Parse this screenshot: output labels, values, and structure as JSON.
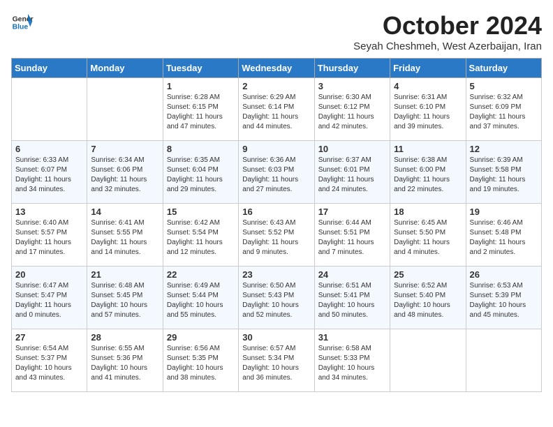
{
  "header": {
    "logo_general": "General",
    "logo_blue": "Blue",
    "month_title": "October 2024",
    "subtitle": "Seyah Cheshmeh, West Azerbaijan, Iran"
  },
  "days_of_week": [
    "Sunday",
    "Monday",
    "Tuesday",
    "Wednesday",
    "Thursday",
    "Friday",
    "Saturday"
  ],
  "weeks": [
    [
      {
        "day": "",
        "info": ""
      },
      {
        "day": "",
        "info": ""
      },
      {
        "day": "1",
        "info": "Sunrise: 6:28 AM\nSunset: 6:15 PM\nDaylight: 11 hours and 47 minutes."
      },
      {
        "day": "2",
        "info": "Sunrise: 6:29 AM\nSunset: 6:14 PM\nDaylight: 11 hours and 44 minutes."
      },
      {
        "day": "3",
        "info": "Sunrise: 6:30 AM\nSunset: 6:12 PM\nDaylight: 11 hours and 42 minutes."
      },
      {
        "day": "4",
        "info": "Sunrise: 6:31 AM\nSunset: 6:10 PM\nDaylight: 11 hours and 39 minutes."
      },
      {
        "day": "5",
        "info": "Sunrise: 6:32 AM\nSunset: 6:09 PM\nDaylight: 11 hours and 37 minutes."
      }
    ],
    [
      {
        "day": "6",
        "info": "Sunrise: 6:33 AM\nSunset: 6:07 PM\nDaylight: 11 hours and 34 minutes."
      },
      {
        "day": "7",
        "info": "Sunrise: 6:34 AM\nSunset: 6:06 PM\nDaylight: 11 hours and 32 minutes."
      },
      {
        "day": "8",
        "info": "Sunrise: 6:35 AM\nSunset: 6:04 PM\nDaylight: 11 hours and 29 minutes."
      },
      {
        "day": "9",
        "info": "Sunrise: 6:36 AM\nSunset: 6:03 PM\nDaylight: 11 hours and 27 minutes."
      },
      {
        "day": "10",
        "info": "Sunrise: 6:37 AM\nSunset: 6:01 PM\nDaylight: 11 hours and 24 minutes."
      },
      {
        "day": "11",
        "info": "Sunrise: 6:38 AM\nSunset: 6:00 PM\nDaylight: 11 hours and 22 minutes."
      },
      {
        "day": "12",
        "info": "Sunrise: 6:39 AM\nSunset: 5:58 PM\nDaylight: 11 hours and 19 minutes."
      }
    ],
    [
      {
        "day": "13",
        "info": "Sunrise: 6:40 AM\nSunset: 5:57 PM\nDaylight: 11 hours and 17 minutes."
      },
      {
        "day": "14",
        "info": "Sunrise: 6:41 AM\nSunset: 5:55 PM\nDaylight: 11 hours and 14 minutes."
      },
      {
        "day": "15",
        "info": "Sunrise: 6:42 AM\nSunset: 5:54 PM\nDaylight: 11 hours and 12 minutes."
      },
      {
        "day": "16",
        "info": "Sunrise: 6:43 AM\nSunset: 5:52 PM\nDaylight: 11 hours and 9 minutes."
      },
      {
        "day": "17",
        "info": "Sunrise: 6:44 AM\nSunset: 5:51 PM\nDaylight: 11 hours and 7 minutes."
      },
      {
        "day": "18",
        "info": "Sunrise: 6:45 AM\nSunset: 5:50 PM\nDaylight: 11 hours and 4 minutes."
      },
      {
        "day": "19",
        "info": "Sunrise: 6:46 AM\nSunset: 5:48 PM\nDaylight: 11 hours and 2 minutes."
      }
    ],
    [
      {
        "day": "20",
        "info": "Sunrise: 6:47 AM\nSunset: 5:47 PM\nDaylight: 11 hours and 0 minutes."
      },
      {
        "day": "21",
        "info": "Sunrise: 6:48 AM\nSunset: 5:45 PM\nDaylight: 10 hours and 57 minutes."
      },
      {
        "day": "22",
        "info": "Sunrise: 6:49 AM\nSunset: 5:44 PM\nDaylight: 10 hours and 55 minutes."
      },
      {
        "day": "23",
        "info": "Sunrise: 6:50 AM\nSunset: 5:43 PM\nDaylight: 10 hours and 52 minutes."
      },
      {
        "day": "24",
        "info": "Sunrise: 6:51 AM\nSunset: 5:41 PM\nDaylight: 10 hours and 50 minutes."
      },
      {
        "day": "25",
        "info": "Sunrise: 6:52 AM\nSunset: 5:40 PM\nDaylight: 10 hours and 48 minutes."
      },
      {
        "day": "26",
        "info": "Sunrise: 6:53 AM\nSunset: 5:39 PM\nDaylight: 10 hours and 45 minutes."
      }
    ],
    [
      {
        "day": "27",
        "info": "Sunrise: 6:54 AM\nSunset: 5:37 PM\nDaylight: 10 hours and 43 minutes."
      },
      {
        "day": "28",
        "info": "Sunrise: 6:55 AM\nSunset: 5:36 PM\nDaylight: 10 hours and 41 minutes."
      },
      {
        "day": "29",
        "info": "Sunrise: 6:56 AM\nSunset: 5:35 PM\nDaylight: 10 hours and 38 minutes."
      },
      {
        "day": "30",
        "info": "Sunrise: 6:57 AM\nSunset: 5:34 PM\nDaylight: 10 hours and 36 minutes."
      },
      {
        "day": "31",
        "info": "Sunrise: 6:58 AM\nSunset: 5:33 PM\nDaylight: 10 hours and 34 minutes."
      },
      {
        "day": "",
        "info": ""
      },
      {
        "day": "",
        "info": ""
      }
    ]
  ]
}
